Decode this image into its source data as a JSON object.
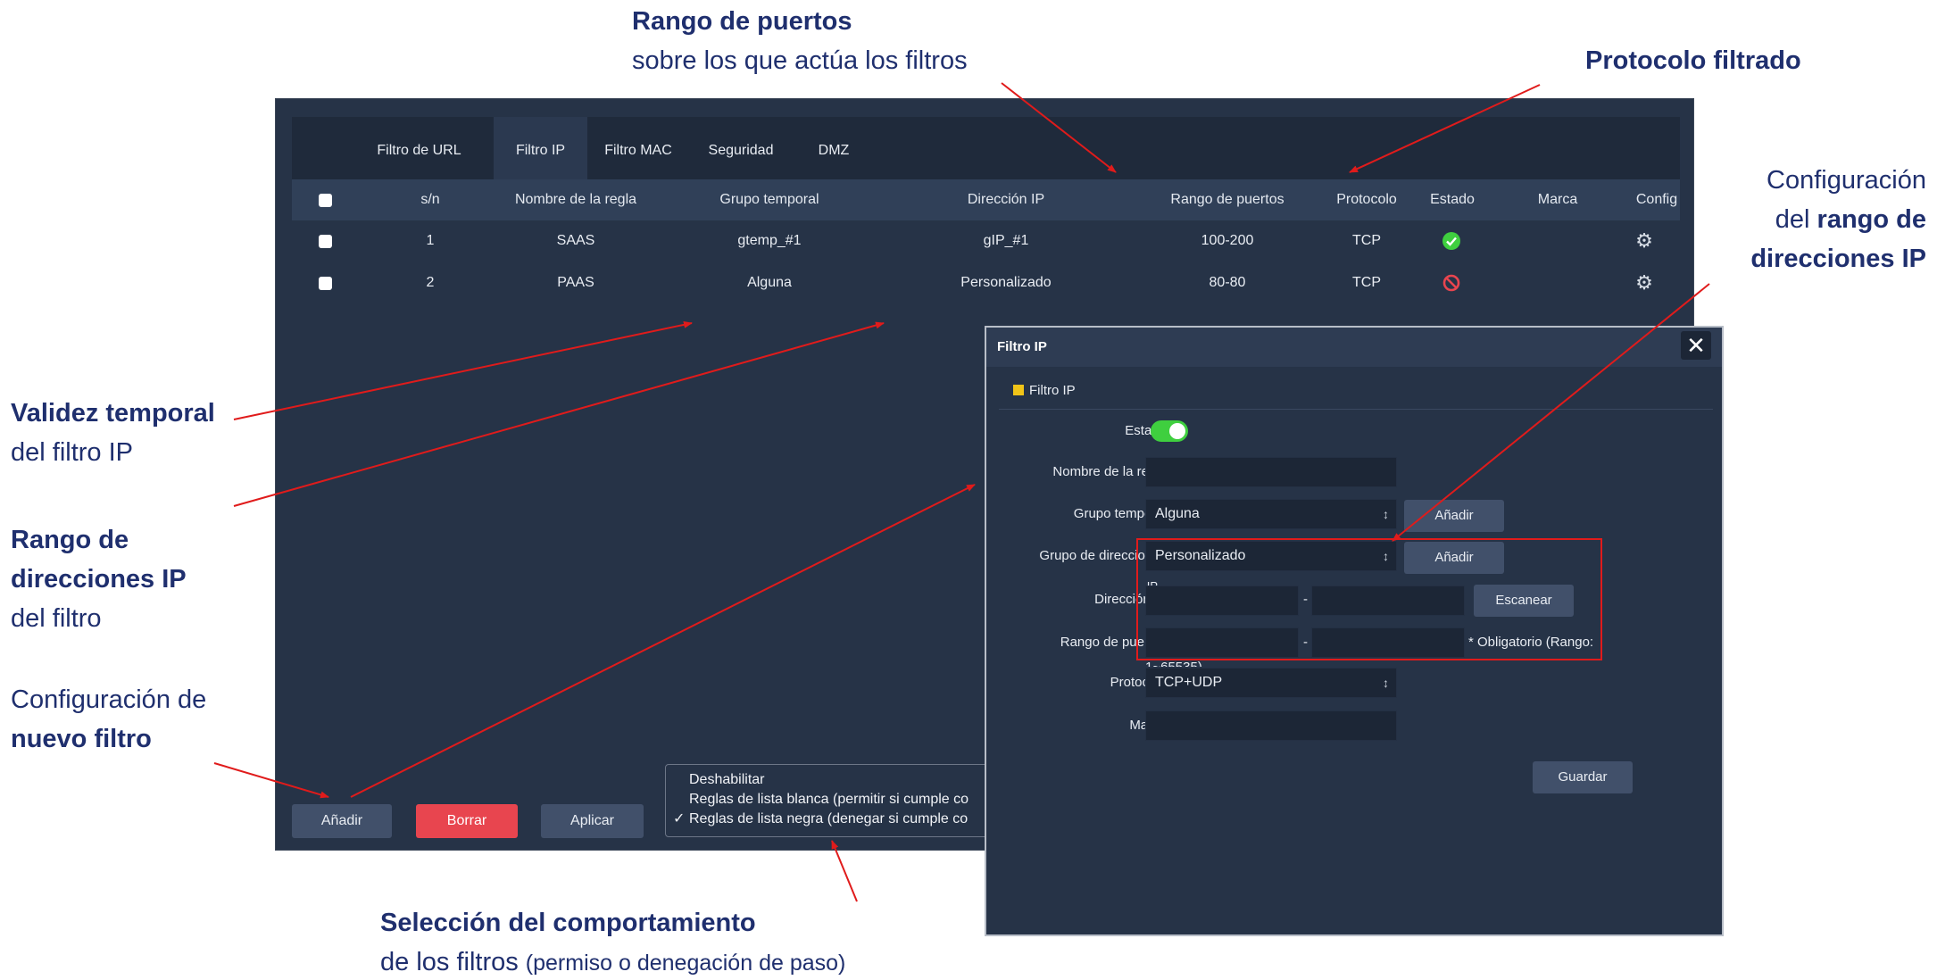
{
  "annotations": {
    "ports_title": "Rango de puertos",
    "ports_sub": "sobre los que actúa los filtros",
    "protocol_title": "Protocolo filtrado",
    "cfg_line1": "Configuración",
    "cfg_line2_prefix": "del ",
    "cfg_line2_bold": "rango de",
    "cfg_line3": "direcciones IP",
    "validity_title": "Validez temporal",
    "validity_sub": "del filtro IP",
    "iprange_line1": "Rango de",
    "iprange_line2": "direcciones IP",
    "iprange_sub": "del filtro",
    "newfilter_line1": "Configuración de",
    "newfilter_line2": "nuevo filtro",
    "behaviour_title": "Selección del comportamiento",
    "behaviour_sub": "de los filtros",
    "behaviour_note": "(permiso o denegación de paso)"
  },
  "tabs": [
    "Filtro de URL",
    "Filtro IP",
    "Filtro MAC",
    "Seguridad",
    "DMZ"
  ],
  "table": {
    "headers": [
      "s/n",
      "Nombre de la regla",
      "Grupo temporal",
      "Dirección IP",
      "Rango de puertos",
      "Protocolo",
      "Estado",
      "Marca",
      "Config"
    ],
    "rows": [
      {
        "sn": "1",
        "name": "SAAS",
        "time_group": "gtemp_#1",
        "ip": "gIP_#1",
        "ports": "100-200",
        "protocol": "TCP",
        "status": "enabled",
        "mark": ""
      },
      {
        "sn": "2",
        "name": "PAAS",
        "time_group": "Alguna",
        "ip": "Personalizado",
        "ports": "80-80",
        "protocol": "TCP",
        "status": "disabled",
        "mark": ""
      }
    ]
  },
  "buttons": {
    "add": "Añadir",
    "delete": "Borrar",
    "apply": "Aplicar"
  },
  "behaviour_menu": {
    "items": [
      "Deshabilitar",
      "Reglas de lista blanca (permitir si cumple co",
      "Reglas de lista negra (denegar si cumple co"
    ],
    "selected_index": 2,
    "check_mark": "✓"
  },
  "dialog": {
    "title": "Filtro IP",
    "close": "✕",
    "section": "Filtro IP",
    "labels": {
      "status": "Estado",
      "rule_name": "Nombre de la regla",
      "time_group": "Grupo temporal",
      "address_group": "Grupo de direcciones",
      "ip_address": "Dirección IP",
      "port_range": "Rango de puertos",
      "protocol": "Protocolo",
      "mark": "Marca"
    },
    "ip_label_overlap": "IP",
    "values": {
      "status_on": true,
      "rule_name": "",
      "time_group": "Alguna",
      "address_group": "Personalizado",
      "ip_start": "",
      "ip_end": "",
      "port_start": "",
      "port_end": "",
      "protocol": "TCP+UDP",
      "mark": ""
    },
    "dash": "-",
    "add_label": "Añadir",
    "scan_label": "Escanear",
    "required_note": "* Obligatorio (Rango:",
    "range_overflow": "1~65535)",
    "save_label": "Guardar"
  }
}
